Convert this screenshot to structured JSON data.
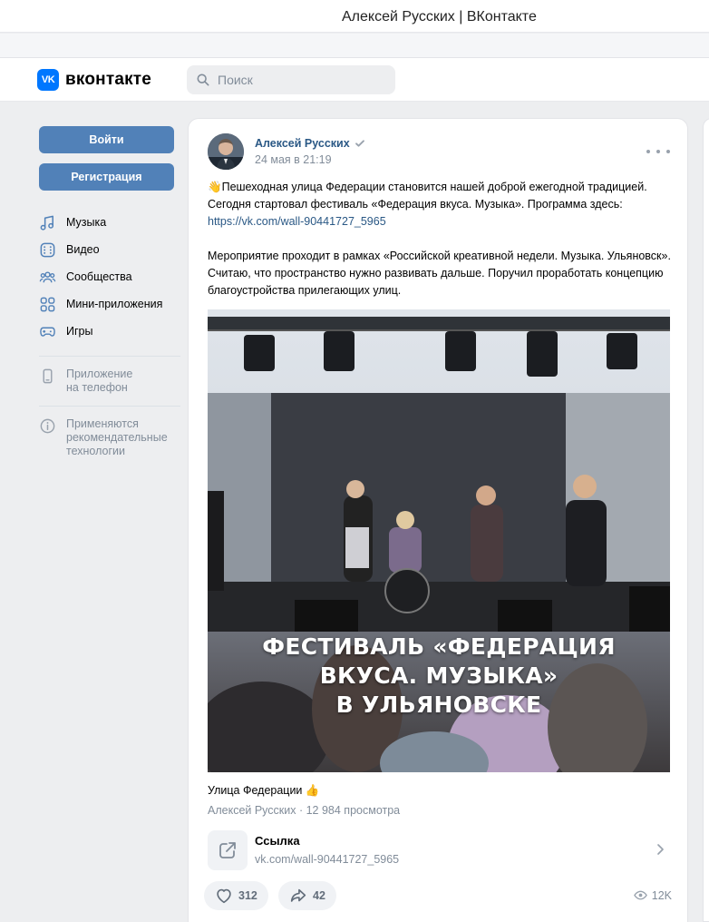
{
  "window": {
    "title": "Алексей Русских | ВКонтакте"
  },
  "header": {
    "logo_mark": "VK",
    "logo_text": "вконтакте",
    "search_placeholder": "Поиск"
  },
  "sidebar": {
    "login_label": "Войти",
    "register_label": "Регистрация",
    "items": [
      {
        "label": "Музыка",
        "icon": "music-note-icon"
      },
      {
        "label": "Видео",
        "icon": "video-icon"
      },
      {
        "label": "Сообщества",
        "icon": "communities-icon"
      },
      {
        "label": "Мини-приложения",
        "icon": "mini-apps-icon"
      },
      {
        "label": "Игры",
        "icon": "gamepad-icon"
      }
    ],
    "app_line1": "Приложение",
    "app_line2": "на телефон",
    "tech_line1": "Применяются",
    "tech_line2": "рекомендательные",
    "tech_line3": "технологии"
  },
  "post": {
    "author": "Алексей Русских",
    "verified": true,
    "date": "24 мая в 21:19",
    "paragraph1_emoji": "👋",
    "paragraph1": "Пешеходная улица Федерации становится нашей доброй ежегодной традицией. Сегодня стартовал фестиваль «Федерация вкуса. Музыка». Программа здесь:",
    "paragraph1_link": "https://vk.com/wall-90441727_5965",
    "paragraph2": "Мероприятие проходит в рамках «Российской креативной недели. Музыка. Ульяновск». Считаю, что пространство нужно развивать дальше. Поручил проработать концепцию благоустройства прилегающих улиц.",
    "media_caption_line1": "ФЕСТИВАЛЬ «ФЕДЕРАЦИЯ",
    "media_caption_line2": "ВКУСА. МУЗЫКА»",
    "media_caption_line3": "В УЛЬЯНОВСКЕ",
    "clip_title": "Улица Федерации 👍",
    "clip_meta": "Алексей Русских · 12 984 просмотра",
    "link_title": "Ссылка",
    "link_url": "vk.com/wall-90441727_5965",
    "likes": "312",
    "shares": "42",
    "views": "12K"
  },
  "colors": {
    "accent": "#5181b8",
    "link": "#2a5885",
    "brand": "#0077ff",
    "muted": "#818c99",
    "background": "#edeef0"
  }
}
